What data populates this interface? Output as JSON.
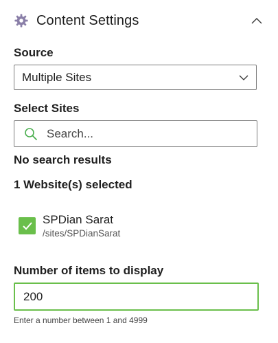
{
  "header": {
    "title": "Content Settings",
    "icon": "gear-icon",
    "collapse_icon": "chevron-up-icon"
  },
  "source": {
    "label": "Source",
    "selected": "Multiple Sites",
    "icon": "chevron-down-icon"
  },
  "select_sites": {
    "label": "Select Sites",
    "search_placeholder": "Search...",
    "search_value": "",
    "search_icon": "search-icon",
    "no_results": "No search results",
    "selected_count": "1 Website(s) selected"
  },
  "sites": [
    {
      "name": "SPDian Sarat",
      "path": "/sites/SPDianSarat",
      "checked": true
    }
  ],
  "items_to_display": {
    "label": "Number of items to display",
    "value": "200",
    "hint": "Enter a number between 1 and 4999"
  },
  "colors": {
    "accent_green": "#6abf4b",
    "search_icon_green": "#4caf50",
    "gear": "#8a7fa8"
  }
}
